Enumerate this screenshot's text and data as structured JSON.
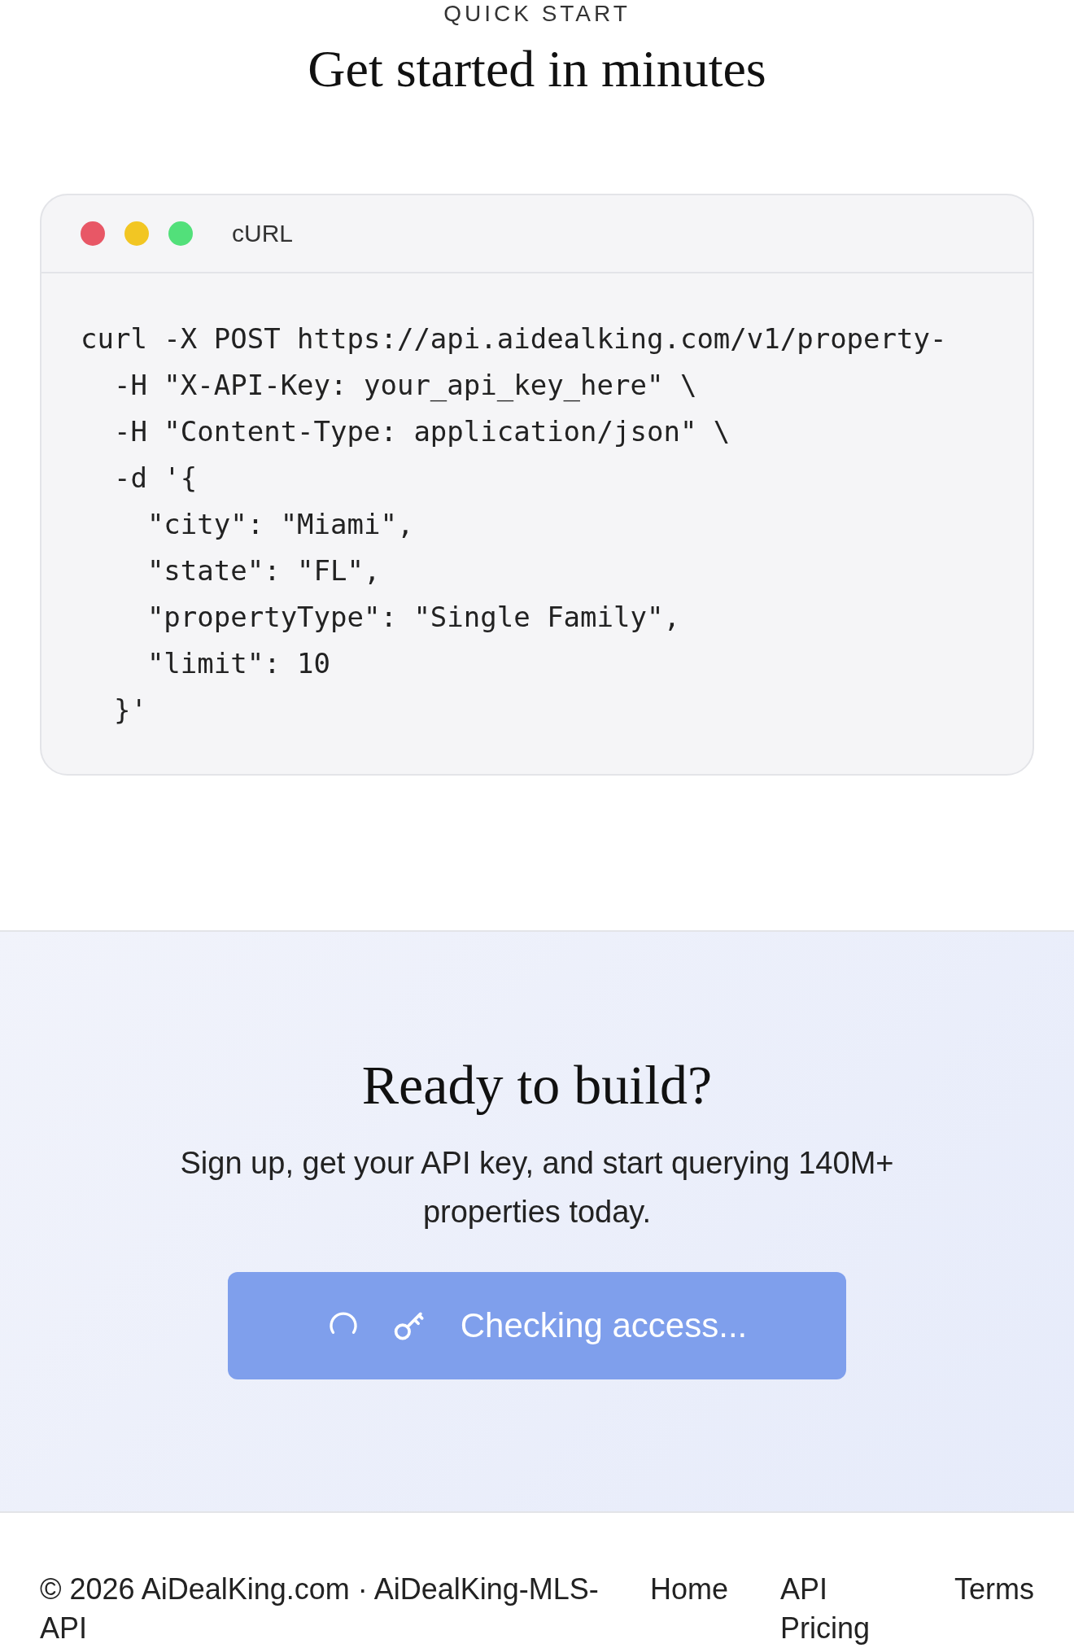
{
  "quick_start": {
    "eyebrow": "QUICK START",
    "heading": "Get started in minutes",
    "code_window": {
      "dots": [
        {
          "color": "#e85766"
        },
        {
          "color": "#f2c623"
        },
        {
          "color": "#52e07a"
        }
      ],
      "title": "cURL",
      "lines": [
        "curl -X POST https://api.aidealking.com/v1/property-",
        "  -H \"X-API-Key: your_api_key_here\" \\",
        "  -H \"Content-Type: application/json\" \\",
        "  -d '{",
        "    \"city\": \"Miami\",",
        "    \"state\": \"FL\",",
        "    \"propertyType\": \"Single Family\",",
        "    \"limit\": 10",
        "  }'"
      ]
    }
  },
  "cta": {
    "heading": "Ready to build?",
    "text": "Sign up, get your API key, and start querying 140M+ properties today.",
    "button": {
      "label": "Checking access...",
      "disabled": true
    }
  },
  "footer": {
    "copyright": "© 2026 AiDealKing.com · AiDealKing-MLS-API",
    "links": [
      "Home",
      "API Pricing",
      "Terms"
    ]
  }
}
